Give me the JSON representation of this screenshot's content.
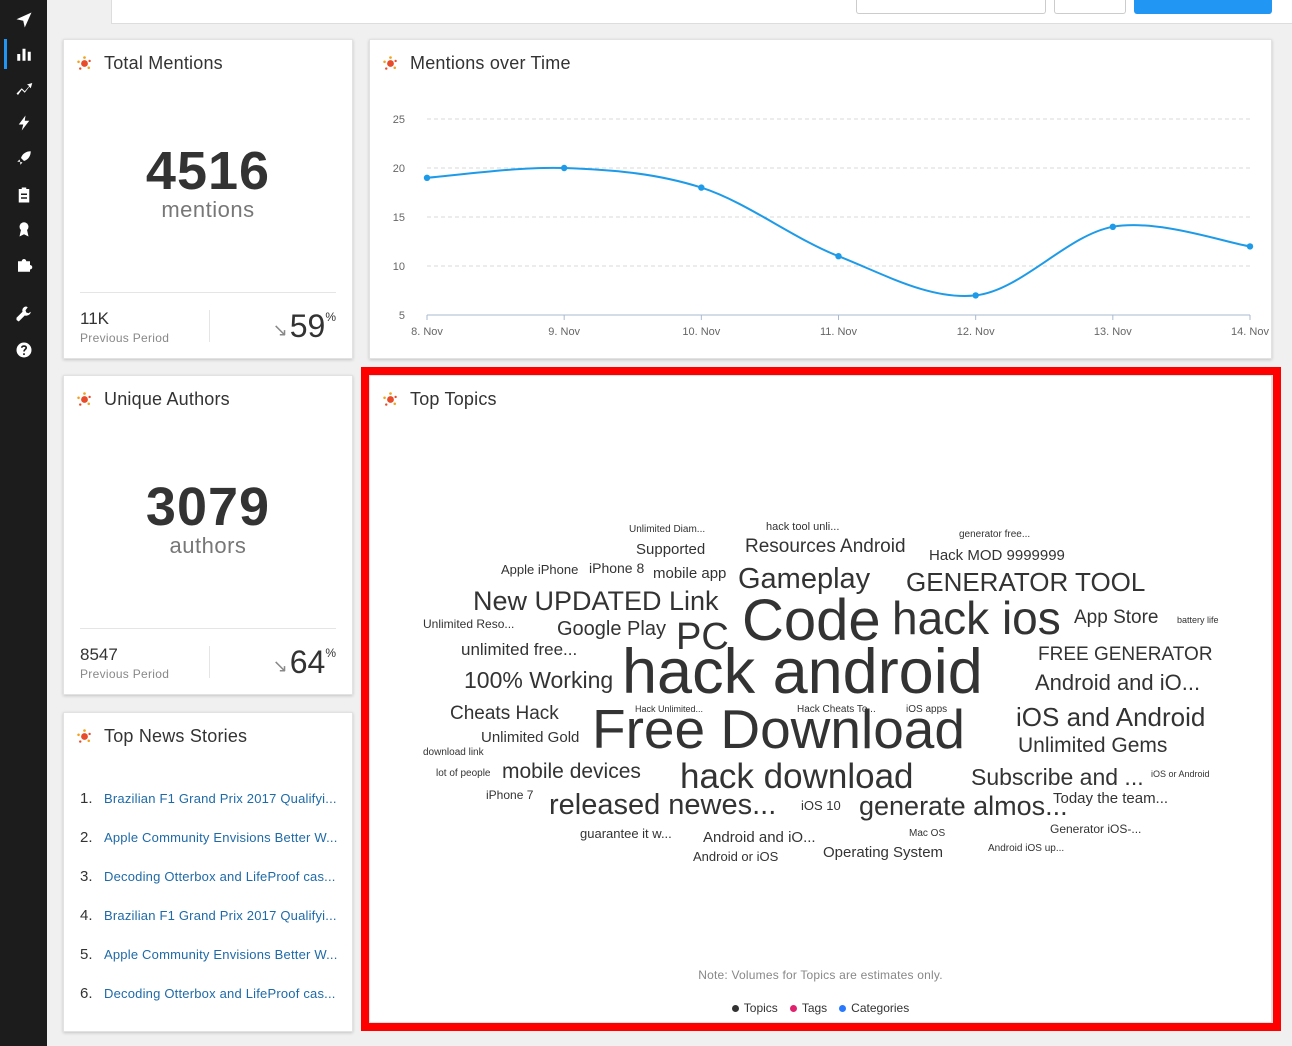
{
  "sidebar": {
    "items": [
      {
        "name": "publish",
        "icon": "paper-plane-icon"
      },
      {
        "name": "analytics",
        "icon": "bar-chart-icon",
        "active": true
      },
      {
        "name": "trends",
        "icon": "trending-up-icon"
      },
      {
        "name": "alerts",
        "icon": "lightning-icon"
      },
      {
        "name": "launch",
        "icon": "rocket-icon"
      },
      {
        "name": "reports",
        "icon": "clipboard-icon"
      },
      {
        "name": "awards",
        "icon": "badge-icon"
      },
      {
        "name": "integrations",
        "icon": "puzzle-icon"
      },
      {
        "name": "settings",
        "icon": "wrench-icon"
      },
      {
        "name": "help",
        "icon": "question-icon"
      }
    ]
  },
  "total_mentions": {
    "title": "Total Mentions",
    "value": "4516",
    "unit": "mentions",
    "previous_value": "11K",
    "previous_label": "Previous Period",
    "change_value": "59",
    "change_unit": "%",
    "change_direction": "down"
  },
  "unique_authors": {
    "title": "Unique Authors",
    "value": "3079",
    "unit": "authors",
    "previous_value": "8547",
    "previous_label": "Previous Period",
    "change_value": "64",
    "change_unit": "%",
    "change_direction": "down"
  },
  "top_news": {
    "title": "Top News Stories",
    "items": [
      {
        "num": "1.",
        "title": "Brazilian F1 Grand Prix 2017 Qualifyi..."
      },
      {
        "num": "2.",
        "title": "Apple Community Envisions Better W..."
      },
      {
        "num": "3.",
        "title": "Decoding Otterbox and LifeProof cas..."
      },
      {
        "num": "4.",
        "title": "Brazilian F1 Grand Prix 2017 Qualifyi..."
      },
      {
        "num": "5.",
        "title": "Apple Community Envisions Better W..."
      },
      {
        "num": "6.",
        "title": "Decoding Otterbox and LifeProof cas..."
      }
    ]
  },
  "mentions_over_time": {
    "title": "Mentions over Time"
  },
  "chart_data": {
    "type": "line",
    "title": "Mentions over Time",
    "categories": [
      "8. Nov",
      "9. Nov",
      "10. Nov",
      "11. Nov",
      "12. Nov",
      "13. Nov",
      "14. Nov"
    ],
    "values": [
      19,
      20,
      18,
      11,
      7,
      14,
      12
    ],
    "yticks": [
      5,
      10,
      15,
      20,
      25
    ],
    "ylim": [
      5,
      25
    ],
    "grid": true,
    "color": "#1e9be8"
  },
  "top_topics": {
    "title": "Top Topics",
    "note": "Note: Volumes for Topics are estimates only.",
    "legend": [
      {
        "label": "Topics",
        "color": "#333333"
      },
      {
        "label": "Tags",
        "color": "#e0226e"
      },
      {
        "label": "Categories",
        "color": "#2979ff"
      }
    ],
    "words": [
      {
        "text": "Unlimited Diam...",
        "size": 10
      },
      {
        "text": "hack tool unli...",
        "size": 11
      },
      {
        "text": "generator free...",
        "size": 10
      },
      {
        "text": "Supported",
        "size": 15
      },
      {
        "text": "Resources Android",
        "size": 19
      },
      {
        "text": "Hack MOD 9999999",
        "size": 15
      },
      {
        "text": "Apple iPhone",
        "size": 13
      },
      {
        "text": "iPhone 8",
        "size": 14
      },
      {
        "text": "mobile app",
        "size": 15
      },
      {
        "text": "Gameplay",
        "size": 29
      },
      {
        "text": "GENERATOR TOOL",
        "size": 26
      },
      {
        "text": "New UPDATED Link",
        "size": 27
      },
      {
        "text": "Code",
        "size": 58
      },
      {
        "text": "hack ios",
        "size": 46
      },
      {
        "text": "App Store",
        "size": 19
      },
      {
        "text": "battery life",
        "size": 9
      },
      {
        "text": "Unlimited Reso...",
        "size": 12
      },
      {
        "text": "Google Play",
        "size": 20
      },
      {
        "text": "PC",
        "size": 38
      },
      {
        "text": "unlimited free...",
        "size": 17
      },
      {
        "text": "FREE GENERATOR",
        "size": 19
      },
      {
        "text": "100% Working",
        "size": 23
      },
      {
        "text": "hack android",
        "size": 63
      },
      {
        "text": "Android and iO...",
        "size": 22
      },
      {
        "text": "Cheats Hack",
        "size": 19
      },
      {
        "text": "Hack Unlimited...",
        "size": 9
      },
      {
        "text": "Hack Cheats To...",
        "size": 10
      },
      {
        "text": "iOS apps",
        "size": 10
      },
      {
        "text": "Unlimited Gold",
        "size": 15
      },
      {
        "text": "Free Download",
        "size": 55
      },
      {
        "text": "iOS and Android",
        "size": 26
      },
      {
        "text": "download link",
        "size": 10
      },
      {
        "text": "Unlimited Gems",
        "size": 21
      },
      {
        "text": "lot of people",
        "size": 10
      },
      {
        "text": "mobile devices",
        "size": 21
      },
      {
        "text": "hack download",
        "size": 35
      },
      {
        "text": "Subscribe and ...",
        "size": 23
      },
      {
        "text": "iOS or Android",
        "size": 9
      },
      {
        "text": "iPhone 7",
        "size": 12
      },
      {
        "text": "released newes...",
        "size": 29
      },
      {
        "text": "iOS 10",
        "size": 13
      },
      {
        "text": "generate almos...",
        "size": 27
      },
      {
        "text": "Today the team...",
        "size": 15
      },
      {
        "text": "guarantee it w...",
        "size": 13
      },
      {
        "text": "Android and iO...",
        "size": 15
      },
      {
        "text": "Mac OS",
        "size": 10
      },
      {
        "text": "Generator iOS-...",
        "size": 12
      },
      {
        "text": "Android or iOS",
        "size": 13
      },
      {
        "text": "Operating System",
        "size": 15
      },
      {
        "text": "Android iOS up...",
        "size": 10
      }
    ]
  }
}
